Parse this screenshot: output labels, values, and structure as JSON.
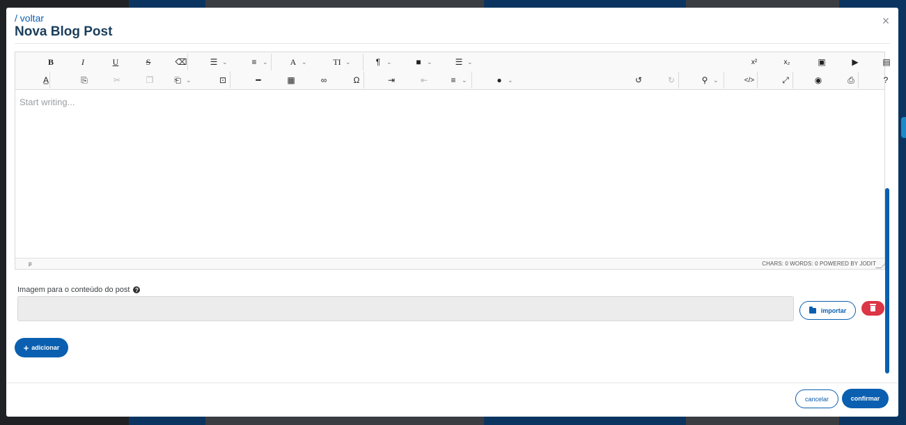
{
  "header": {
    "back_link": "/ voltar",
    "title": "Nova Blog Post",
    "close_symbol": "×"
  },
  "toolbar": {
    "row1": [
      {
        "name": "bold-icon",
        "glyph": "B",
        "dropdown": false
      },
      {
        "name": "italic-icon",
        "glyph": "I",
        "dropdown": false
      },
      {
        "name": "underline-icon",
        "glyph": "U",
        "dropdown": false
      },
      {
        "name": "strikethrough-icon",
        "glyph": "S",
        "dropdown": false
      },
      {
        "name": "eraser-icon",
        "glyph": "⌫",
        "dropdown": false
      },
      {
        "name": "unordered-list-icon",
        "glyph": "☰",
        "dropdown": true
      },
      {
        "name": "ordered-list-icon",
        "glyph": "≡",
        "dropdown": true
      },
      {
        "name": "font-icon",
        "glyph": "A",
        "dropdown": true
      },
      {
        "name": "font-size-icon",
        "glyph": "TI",
        "dropdown": true
      },
      {
        "name": "paragraph-icon",
        "glyph": "¶",
        "dropdown": true
      },
      {
        "name": "classname-icon",
        "glyph": "■",
        "dropdown": true
      },
      {
        "name": "line-height-icon",
        "glyph": "☰",
        "dropdown": true
      },
      {
        "name": "superscript-icon",
        "glyph": "x²",
        "dropdown": false
      },
      {
        "name": "subscript-icon",
        "glyph": "x₂",
        "dropdown": false
      },
      {
        "name": "image-icon",
        "glyph": "▣",
        "dropdown": false
      },
      {
        "name": "video-icon",
        "glyph": "▶",
        "dropdown": false
      },
      {
        "name": "file-icon",
        "glyph": "▤",
        "dropdown": false
      }
    ],
    "row2": [
      {
        "name": "spellcheck-icon",
        "glyph": "A̲",
        "dropdown": false
      },
      {
        "name": "copy-format-icon",
        "glyph": "⎘",
        "dropdown": false
      },
      {
        "name": "cut-icon",
        "glyph": "✂",
        "dropdown": false
      },
      {
        "name": "copy-icon",
        "glyph": "❐",
        "dropdown": false
      },
      {
        "name": "paste-icon",
        "glyph": "⎗",
        "dropdown": true
      },
      {
        "name": "select-all-icon",
        "glyph": "⊡",
        "dropdown": false
      },
      {
        "name": "horizontal-rule-icon",
        "glyph": "━",
        "dropdown": false
      },
      {
        "name": "table-icon",
        "glyph": "▦",
        "dropdown": false
      },
      {
        "name": "link-icon",
        "glyph": "∞",
        "dropdown": false
      },
      {
        "name": "symbols-icon",
        "glyph": "Ω",
        "dropdown": false
      },
      {
        "name": "indent-icon",
        "glyph": "⇥",
        "dropdown": false
      },
      {
        "name": "outdent-icon",
        "glyph": "⇤",
        "dropdown": false
      },
      {
        "name": "align-icon",
        "glyph": "≡",
        "dropdown": true
      },
      {
        "name": "brush-icon",
        "glyph": "●",
        "dropdown": true
      },
      {
        "name": "undo-icon",
        "glyph": "↺",
        "dropdown": false
      },
      {
        "name": "redo-icon",
        "glyph": "↻",
        "dropdown": false
      },
      {
        "name": "search-icon",
        "glyph": "⚲",
        "dropdown": true
      },
      {
        "name": "source-icon",
        "glyph": "</>",
        "dropdown": false
      },
      {
        "name": "fullsize-icon",
        "glyph": "⤢",
        "dropdown": false
      },
      {
        "name": "preview-icon",
        "glyph": "◉",
        "dropdown": false
      },
      {
        "name": "print-icon",
        "glyph": "⎙",
        "dropdown": false
      },
      {
        "name": "about-icon",
        "glyph": "?",
        "dropdown": false
      }
    ]
  },
  "editor": {
    "placeholder": "Start writing...",
    "status_path": "p",
    "status_right": "CHARS: 0   WORDS: 0   POWERED BY JODIT"
  },
  "image_field": {
    "label": "Imagem para o conteúdo do post",
    "help_icon": "?",
    "value": "",
    "import_label": "importar"
  },
  "actions": {
    "add_label": "adicionar",
    "add_plus": "+",
    "cancel_label": "cancelar",
    "confirm_label": "confirmar"
  },
  "colors": {
    "primary": "#0a5fb0",
    "danger": "#dc3545",
    "title": "#1a3e5c"
  }
}
